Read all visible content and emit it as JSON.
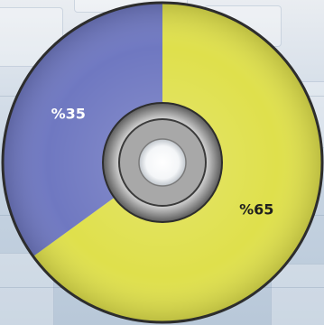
{
  "chart_data": {
    "type": "pie",
    "categories": [
      "%65",
      "%35"
    ],
    "values": [
      65,
      35
    ],
    "labels": [
      "%65",
      "%35"
    ],
    "colors": [
      "#dfe04c",
      "#6f78c1"
    ],
    "label_colors": [
      "#1f1f1f",
      "#ffffff"
    ],
    "start_angle_deg": 0,
    "direction": "clockwise"
  }
}
